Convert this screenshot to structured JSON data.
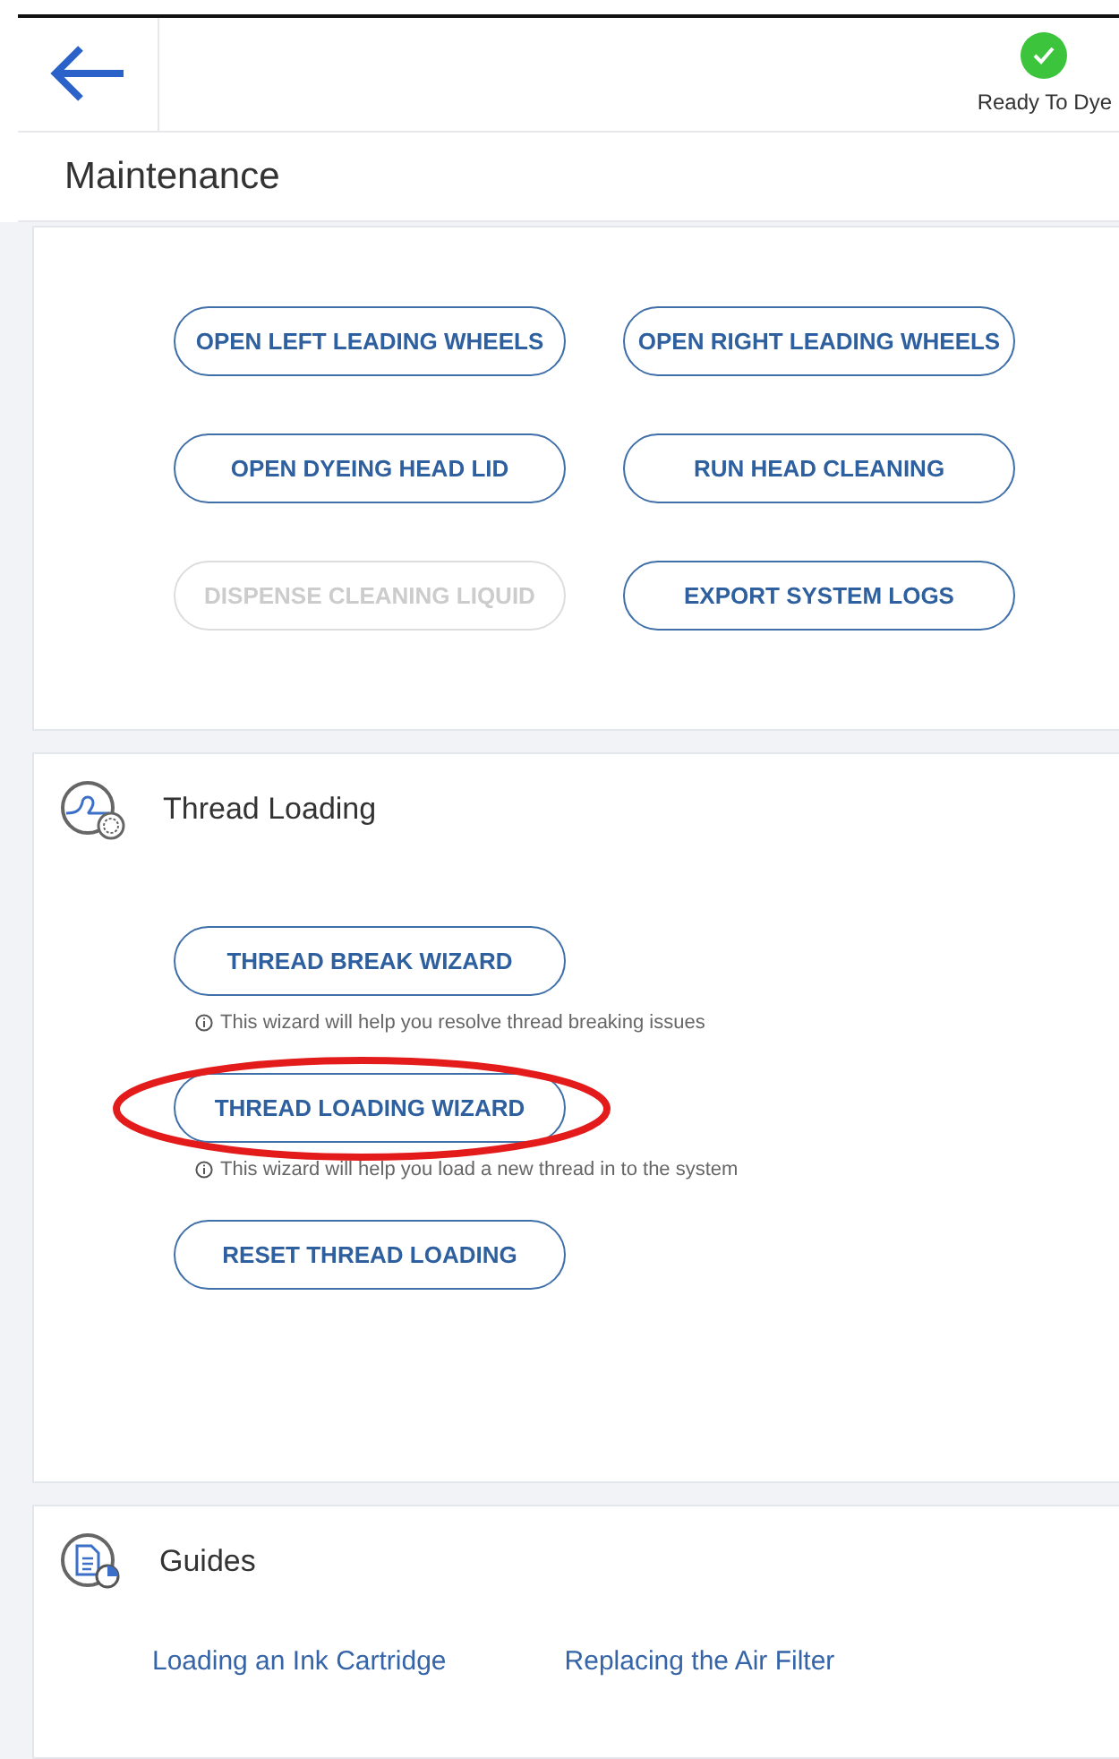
{
  "header": {
    "status": {
      "label": "Ready To Dye",
      "ok": true
    }
  },
  "page_title": "Maintenance",
  "actions": [
    {
      "label": "OPEN LEFT LEADING WHEELS",
      "disabled": false
    },
    {
      "label": "OPEN RIGHT LEADING WHEELS",
      "disabled": false
    },
    {
      "label": "OPEN DYEING HEAD LID",
      "disabled": false
    },
    {
      "label": "RUN HEAD CLEANING",
      "disabled": false
    },
    {
      "label": "DISPENSE CLEANING LIQUID",
      "disabled": true
    },
    {
      "label": "EXPORT SYSTEM LOGS",
      "disabled": false
    }
  ],
  "thread_loading": {
    "title": "Thread Loading",
    "items": [
      {
        "label": "THREAD BREAK WIZARD",
        "hint": "This wizard will help you resolve thread breaking issues",
        "circled": false
      },
      {
        "label": "THREAD LOADING WIZARD",
        "hint": "This wizard will help you load a new thread in to the system",
        "circled": true
      },
      {
        "label": "RESET THREAD LOADING",
        "circled": false
      }
    ]
  },
  "guides": {
    "title": "Guides",
    "links": [
      "Loading an Ink Cartridge",
      "Replacing the Air Filter"
    ]
  }
}
